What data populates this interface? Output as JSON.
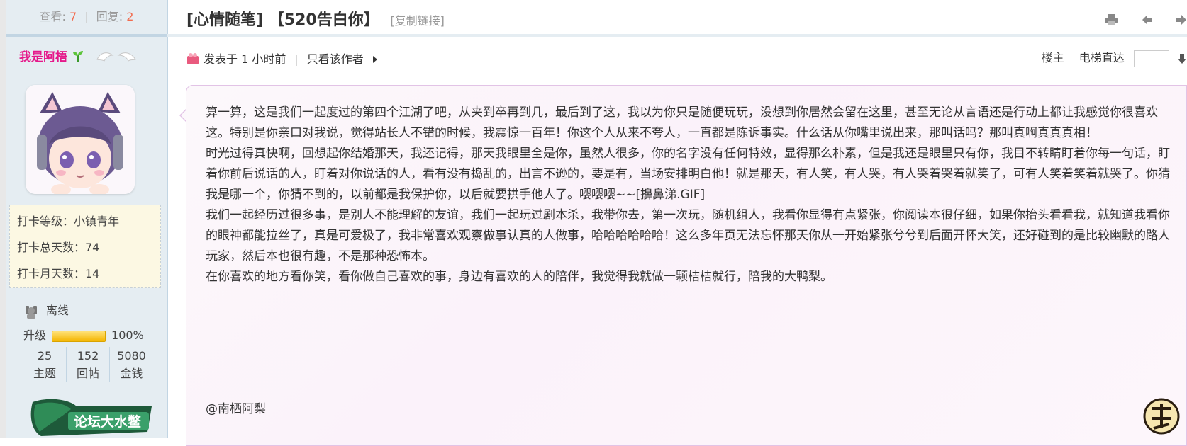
{
  "sidebar": {
    "views_label": "查看:",
    "views": "7",
    "replies_label": "回复:",
    "replies": "2",
    "username": "我是阿梧",
    "checkin": {
      "level": "打卡等级：小镇青年",
      "total_days": "打卡总天数：74",
      "month_days": "打卡月天数：14"
    },
    "status": "离线",
    "level_label": "升级",
    "level_percent": "100%",
    "level_progress": 1.0,
    "counts": [
      {
        "value": "25",
        "label": "主题"
      },
      {
        "value": "152",
        "label": "回帖"
      },
      {
        "value": "5080",
        "label": "金钱"
      }
    ],
    "badge_text": "论坛大水鳖"
  },
  "thread": {
    "title": "[心情随笔] 【520告白你】",
    "copy_link": "[复制链接]"
  },
  "meta": {
    "posted": "发表于 1 小时前",
    "only_author": "只看该作者",
    "floor": "楼主",
    "jump_label": "电梯直达"
  },
  "post": {
    "paragraphs": [
      "算一算，这是我们一起度过的第四个江湖了吧，从夹到卒再到几，最后到了这，我以为你只是随便玩玩，没想到你居然会留在这里，甚至无论从言语还是行动上都让我感觉你很喜欢这。特别是你亲口对我说，觉得站长人不错的时候，我震惊一百年！你这个人从来不夸人，一直都是陈诉事实。什么话从你嘴里说出来，那叫话吗？那叫真啊真真真相！",
      "时光过得真快啊，回想起你结婚那天，我还记得，那天我眼里全是你，虽然人很多，你的名字没有任何特效，显得那么朴素，但是我还是眼里只有你，我目不转睛盯着你每一句话，盯着你前后说话的人，盯着对你说话的人，看有没有捣乱的，出言不逊的，要是有，当场安排明白他！就是那天，有人笑，有人哭，有人哭着哭着就笑了，可有人笑着笑着就哭了。你猜我是哪一个，你猜不到的，以前都是我保护你，以后就要拱手他人了。嘤嘤嘤~~[擤鼻涕.GIF]",
      "我们一起经历过很多事，是别人不能理解的友谊，我们一起玩过剧本杀，我带你去，第一次玩，随机组人，我看你显得有点紧张，你阅读本很仔细，如果你抬头看看我，就知道我看你的眼神都能拉丝了，真是可爱极了，我非常喜欢观察做事认真的人做事，哈哈哈哈哈哈！这么多年页无法忘怀那天你从一开始紧张兮兮到后面开怀大笑，还好碰到的是比较幽默的路人玩家，然后本也很有趣，不是那种恐怖本。",
      "在你喜欢的地方看你笑，看你做自己喜欢的事，身边有喜欢的人的陪伴，我觉得我就做一颗桔桔就行，陪我的大鸭梨。"
    ],
    "mention": "@南栖阿梨"
  },
  "colors": {
    "username": "#e5188a",
    "count_highlight": "#f26c4f",
    "sidebar_bg": "#e5edf2",
    "post_border": "#e2c3e6"
  }
}
